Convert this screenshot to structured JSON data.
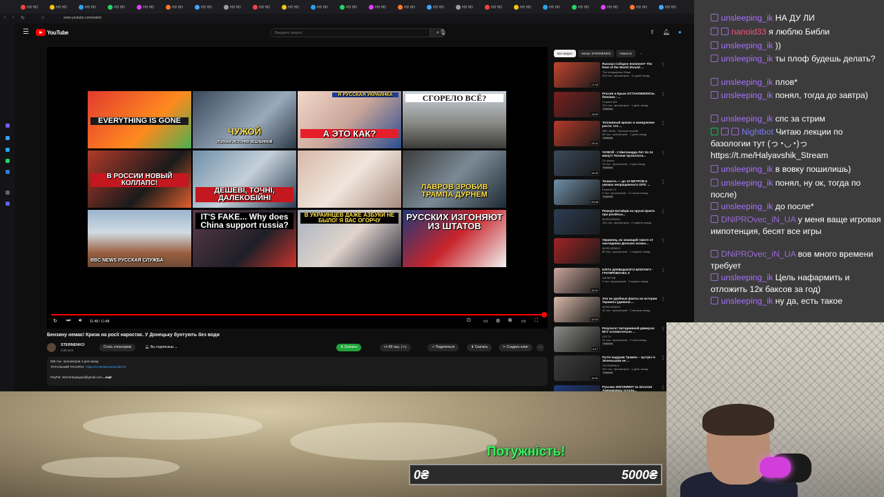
{
  "browser": {
    "url": "www.youtube.com/watch",
    "tab_labels": [
      "HD HD",
      "HD HD",
      "HD HD",
      "HD HD",
      "HD HD",
      "HD HD",
      "HD HD",
      "HD HD",
      "HD HD",
      "HD HD",
      "HD HD",
      "HD HD",
      "HD HD",
      "HD HD",
      "HD HD",
      "HD HD",
      "HD HD",
      "HD HD",
      "HD HD",
      "HD HD",
      "HD HD",
      "HD HD",
      "HD HD"
    ]
  },
  "youtube": {
    "logo_text": "YouTube",
    "search_placeholder": "Введите запрос",
    "player": {
      "time": "11:48 / 11:48",
      "progress": 1.0,
      "thumb_captions": [
        "EVERYTHING IS GONE",
        "ЧУЖОЙ",
        "А ЭТО КАК?",
        "СГОРЕЛО ВСЁ?",
        "В РОССИИ НОВЫЙ КОЛЛАПС!",
        "ДЕШЕВІ, ТОЧНІ, ДАЛЕКОБІЙНІ",
        "",
        "ЛАВРОВ ЗРОБИВ ТРАМПА ДУРНЕМ",
        "BBC NEWS РУССКАЯ СЛУЖБА",
        "IT'S FAKE... Why does China support russia?",
        "В УКРАИНЦЕВ ДАЖЕ АЗБУКИ НЕ БЫЛО! Я ВАС ОГОРЧУ",
        "РУССКИХ ИЗГОНЯЮТ ИЗ ШТАТОВ"
      ],
      "thumb_sub_caption": "ПОЛНАЯ ИСТОРИЯ ВСЕЛЕННОЙ",
      "thumb_banner": "Я РУССКАЯ УКРАИНКА"
    },
    "video_title": "Бензину немає! Криза на росії наростає. У Донецьку бунтують без води",
    "channel": {
      "name": "STERNENKO",
      "subs": "2,08 млн",
      "sponsor_label": "Стать спонсором",
      "subscribed_label": "Вы подписаны"
    },
    "actions": {
      "download_green": "Скачать",
      "likes": "69 тыс.",
      "share": "Поделиться",
      "download": "Скачать",
      "clip": "Создать клип"
    },
    "description": {
      "line1": "505 тыс. просмотров  4 дня назад",
      "line2_prefix": "ТОТАЛЬНИЙ РУСОРІЗ - ",
      "line2_link": "https://t.me/sternenko/48176",
      "line3": "PayPal: sternenkopaypal@gmail.com",
      "more": "...ещё"
    },
    "chips": [
      "Все видео",
      "Автор: STERNENKO",
      "Новости"
    ],
    "recommendations": [
      {
        "title": "Russian Collapse Imminent? The Rest of the World Should ...",
        "channel": "The Infographics Show",
        "stats": "328 тыс. просмотров · 11 дней назад",
        "duration": "17:43",
        "badge": ""
      },
      {
        "title": "Россия и Крым ОСТАНОВИЛИСЬ: бензина - ...",
        "channel": "Страна 404",
        "stats": "129 тыс. просмотров · 1 день назад",
        "duration": "13:02",
        "badge": "Новинка"
      },
      {
        "title": "Топливный кризис и замедление роста: что ...",
        "channel": "BBC News - Русская служба",
        "stats": "65 тыс. просмотров · 1 день назад",
        "duration": "23:11",
        "badge": "Новинка"
      },
      {
        "title": "ЧУЖОЙ - 2 Миллиарда Лет За 14 минут! Полная Хронологи...",
        "channel": "По факту",
        "stats": "29 тыс. просмотров · 4 дня назад",
        "duration": "14:02",
        "badge": "Новинка"
      },
      {
        "title": "Точность — до 10 МЕТРОВ в умовах непрацюючого GPS: ...",
        "channel": "Express TV",
        "stats": "9 тыс. просмотров · 12 часов назад",
        "duration": "20:08",
        "badge": "Новинка"
      },
      {
        "title": "Реакція Китайців на зручні факти про російськ...",
        "channel": "MOROZENKO",
        "stats": "130 тыс. просмотров · 2 недели назад",
        "duration": "",
        "badge": ""
      },
      {
        "title": "Украинец, но знающий такого от наследника Донских козако...",
        "channel": "MOROZENKO",
        "stats": "80 тыс. просмотров · 1 неделю назад",
        "duration": "",
        "badge": ""
      },
      {
        "title": "ЕЛІТА ДОНЕЦЬКОГО БЛОГІНГУ - ГРУПІРОВОЧКА Z",
        "channel": "ШЕЛЕГОВ",
        "stats": "2 тыс. просмотров · 2 недели назад",
        "duration": "15:41",
        "badge": ""
      },
      {
        "title": "Эти не удобные факты из истории Украины удивили ...",
        "channel": "MOROZENKO",
        "stats": "32 тыс. просмотров · 2 месяца назад",
        "duration": "12:22",
        "badge": ""
      },
      {
        "title": "Результат питэдневной движухи: ВСУ основательно ...",
        "channel": "ОЛІ ТУ",
        "stats": "31 тыс. просмотров · 2 часа назад",
        "duration": "8:17",
        "badge": "Новинка"
      },
      {
        "title": "Путін надурив Трампа – зустріч із Зеленським не ...",
        "channel": "STERNENKO",
        "stats": "301 тыс. просмотров · 1 день назад",
        "duration": "10:41",
        "badge": "Новинка"
      },
      {
        "title": "Русских ИЗГОНЯЮТ из Штатов! Американцы устали...",
        "channel": "",
        "stats": "",
        "duration": "",
        "badge": ""
      }
    ]
  },
  "chat": {
    "messages": [
      {
        "user": "unsleeping_ik",
        "text": "НА ДУ ЛИ",
        "user_color": "#a970ff",
        "badges": 1
      },
      {
        "user": "nanoid33",
        "text": "я люблю Библи",
        "user_color": "#ff4f7b",
        "badges": 2
      },
      {
        "user": "unsleeping_ik",
        "text": "))",
        "user_color": "#a970ff",
        "badges": 1
      },
      {
        "user": "unsleeping_ik",
        "text": "ты плоф будешь делать?",
        "user_color": "#a970ff",
        "badges": 1
      },
      {
        "user": "unsleeping_ik",
        "text": "плов*",
        "user_color": "#a970ff",
        "badges": 1
      },
      {
        "user": "unsleeping_ik",
        "text": "понял, тогда до завтра)",
        "user_color": "#a970ff",
        "badges": 1
      },
      {
        "user": "unsleeping_ik",
        "text": "спс за стрим",
        "user_color": "#a970ff",
        "badges": 1
      },
      {
        "user": "Nightbot",
        "text": "Читаю лекции по базологии тут (っ◔◡◔)っ https://t.me/Halyavshik_Stream",
        "user_color": "#7c7cf5",
        "badges": 3
      },
      {
        "user": "unsleeping_ik",
        "text": "в вовку пошилишь)",
        "user_color": "#a970ff",
        "badges": 1
      },
      {
        "user": "unsleeping_ik",
        "text": "понял, ну ок, тогда по после)",
        "user_color": "#a970ff",
        "badges": 1
      },
      {
        "user": "unsleeping_ik",
        "text": "до после*",
        "user_color": "#a970ff",
        "badges": 1
      },
      {
        "user": "DNiPROvec_iN_UA",
        "text": "у меня ваще игровая импотенция, бесят все игры",
        "user_color": "#9b6bd6",
        "badges": 1
      },
      {
        "user": "DNiPROvec_iN_UA",
        "text": "вов много времени требует",
        "user_color": "#9b6bd6",
        "badges": 1
      },
      {
        "user": "unsleeping_ik",
        "text": "Цель нафармить и отложить 12к баксов за год)",
        "user_color": "#a970ff",
        "badges": 1
      },
      {
        "user": "unsleeping_ik",
        "text": "ну да, есть такое",
        "user_color": "#a970ff",
        "badges": 1
      }
    ]
  },
  "donation": {
    "title": "Потужність!",
    "min": "0₴",
    "max": "5000₴",
    "progress": 0.0,
    "accent": "#3af063"
  },
  "icons": [
    "menu-icon",
    "search-icon",
    "mic-icon",
    "upload-icon",
    "bell-icon",
    "replay-icon",
    "next-icon",
    "volume-icon",
    "settings-icon",
    "fullscreen-icon",
    "like-icon",
    "dislike-icon",
    "share-icon",
    "download-icon",
    "more-icon"
  ]
}
